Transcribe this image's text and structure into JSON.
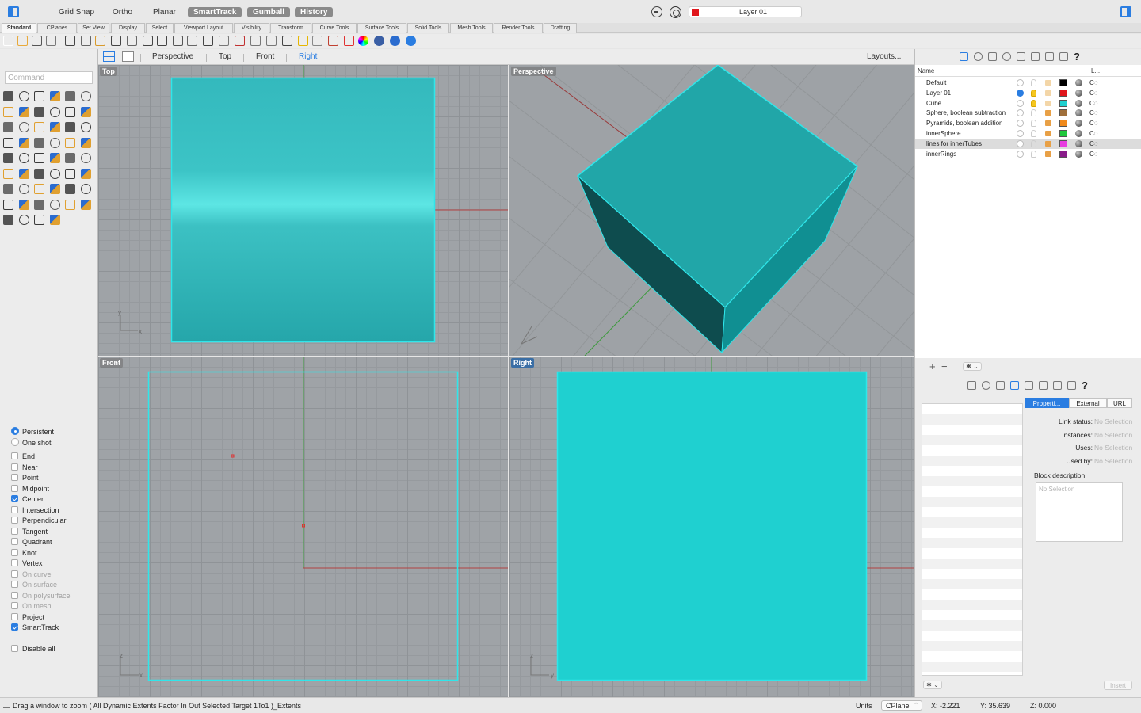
{
  "titlebar": {
    "modes": [
      "Grid Snap",
      "Ortho",
      "Planar"
    ],
    "mode_buttons": [
      "SmartTrack",
      "Gumball",
      "History"
    ],
    "current_layer": "Layer 01",
    "current_layer_color": "#e0161c"
  },
  "tabs": [
    "Standard",
    "CPlanes",
    "Set View",
    "Display",
    "Select",
    "Viewport Layout",
    "Visibility",
    "Transform",
    "Curve Tools",
    "Surface Tools",
    "Solid Tools",
    "Mesh Tools",
    "Render Tools",
    "Drafting"
  ],
  "active_tab": "Standard",
  "command": {
    "placeholder": "Command"
  },
  "viewport_tabs": [
    "Perspective",
    "Top",
    "Front",
    "Right"
  ],
  "active_viewport_tab": "Right",
  "layouts_label": "Layouts...",
  "viewports": {
    "top": "Top",
    "perspective": "Perspective",
    "front": "Front",
    "right": "Right"
  },
  "axis_labels": {
    "x": "x",
    "y": "y",
    "z": "z"
  },
  "object_color": "#1fd0d0",
  "osnap": {
    "modes": [
      {
        "label": "Persistent",
        "selected": true
      },
      {
        "label": "One shot",
        "selected": false
      }
    ],
    "items": [
      {
        "label": "End",
        "checked": false,
        "disabled": false
      },
      {
        "label": "Near",
        "checked": false,
        "disabled": false
      },
      {
        "label": "Point",
        "checked": false,
        "disabled": false
      },
      {
        "label": "Midpoint",
        "checked": false,
        "disabled": false
      },
      {
        "label": "Center",
        "checked": true,
        "disabled": false
      },
      {
        "label": "Intersection",
        "checked": false,
        "disabled": false
      },
      {
        "label": "Perpendicular",
        "checked": false,
        "disabled": false
      },
      {
        "label": "Tangent",
        "checked": false,
        "disabled": false
      },
      {
        "label": "Quadrant",
        "checked": false,
        "disabled": false
      },
      {
        "label": "Knot",
        "checked": false,
        "disabled": false
      },
      {
        "label": "Vertex",
        "checked": false,
        "disabled": false
      },
      {
        "label": "On curve",
        "checked": false,
        "disabled": true
      },
      {
        "label": "On surface",
        "checked": false,
        "disabled": true
      },
      {
        "label": "On polysurface",
        "checked": false,
        "disabled": true
      },
      {
        "label": "On mesh",
        "checked": false,
        "disabled": true
      },
      {
        "label": "Project",
        "checked": false,
        "disabled": false
      },
      {
        "label": "SmartTrack",
        "checked": true,
        "disabled": false
      }
    ],
    "disable_all": "Disable all"
  },
  "layers": {
    "columns": {
      "name": "Name",
      "linetype": "L..."
    },
    "rows": [
      {
        "name": "Default",
        "current": false,
        "on": false,
        "locked": false,
        "color": "#000000",
        "linetype": "C◌"
      },
      {
        "name": "Layer 01",
        "current": true,
        "on": true,
        "locked": false,
        "color": "#e0161c",
        "linetype": "C◌"
      },
      {
        "name": "Cube",
        "current": false,
        "on": true,
        "locked": false,
        "color": "#1fd0d0",
        "linetype": "C◌"
      },
      {
        "name": "Sphere, boolean subtraction",
        "current": false,
        "on": false,
        "locked": true,
        "color": "#a0703c",
        "linetype": "C◌"
      },
      {
        "name": "Pyramids, boolean addition",
        "current": false,
        "on": false,
        "locked": true,
        "color": "#f08a1c",
        "linetype": "C◌"
      },
      {
        "name": "innerSphere",
        "current": false,
        "on": false,
        "locked": true,
        "color": "#1fc83c",
        "linetype": "C◌"
      },
      {
        "name": "lines for innerTubes",
        "current": false,
        "on": false,
        "locked": true,
        "color": "#e83ce0",
        "linetype": "C◌"
      },
      {
        "name": "innerRings",
        "current": false,
        "on": false,
        "locked": true,
        "color": "#8a1c8a",
        "linetype": "C◌"
      }
    ],
    "selected_row": "lines for innerTubes",
    "footer": {
      "add": "+",
      "remove": "−"
    }
  },
  "block": {
    "tabs": [
      "Properti...",
      "External",
      "URL"
    ],
    "active_tab": "Properti...",
    "fields": [
      {
        "label": "Link status:",
        "value": "No Selection"
      },
      {
        "label": "Instances:",
        "value": "No Selection"
      },
      {
        "label": "Uses:",
        "value": "No Selection"
      },
      {
        "label": "Used by:",
        "value": "No Selection"
      }
    ],
    "description_label": "Block description:",
    "description_value": "No Selection",
    "insert_label": "Insert"
  },
  "status": {
    "message": "Drag a window to zoom ( All Dynamic Extents Factor In Out Selected Target 1To1 )_Extents",
    "units_label": "Units",
    "cplane": "CPlane",
    "x": "X: -2.221",
    "y": "Y: 35.639",
    "z": "Z: 0.000"
  }
}
